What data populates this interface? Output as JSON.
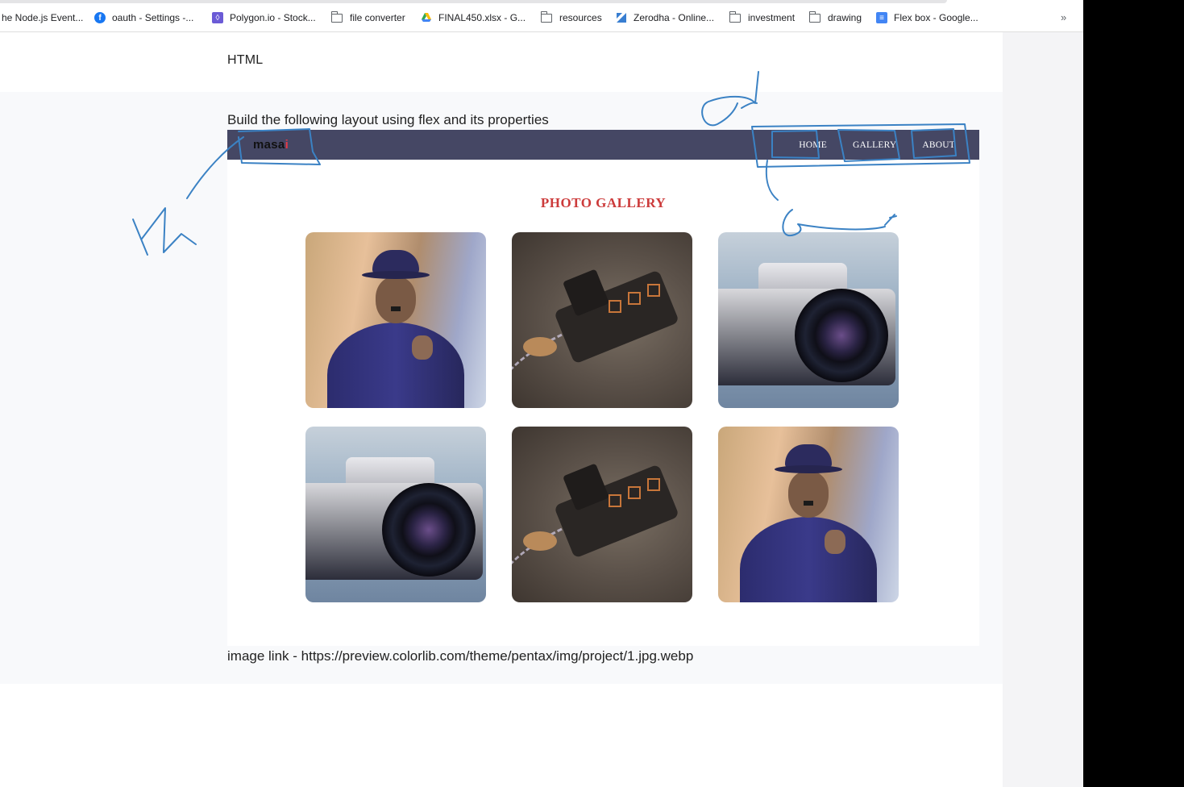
{
  "bookmarks": [
    {
      "label": "he Node.js Event...",
      "icon": "none"
    },
    {
      "label": "oauth - Settings -...",
      "icon": "facebook-icon"
    },
    {
      "label": "Polygon.io - Stock...",
      "icon": "polygon-icon"
    },
    {
      "label": "file converter",
      "icon": "folder-icon"
    },
    {
      "label": "FINAL450.xlsx - G...",
      "icon": "drive-icon"
    },
    {
      "label": "resources",
      "icon": "folder-icon"
    },
    {
      "label": "Zerodha - Online...",
      "icon": "zerodha-icon"
    },
    {
      "label": "investment",
      "icon": "folder-icon"
    },
    {
      "label": "drawing",
      "icon": "folder-icon"
    },
    {
      "label": "Flex box - Google...",
      "icon": "docs-icon"
    }
  ],
  "bookmarks_overflow": "»",
  "doc": {
    "heading": "HTML",
    "task": "Build the following layout using flex and its properties",
    "image_link": "image link - https://preview.colorlib.com/theme/pentax/img/project/1.jpg.webp"
  },
  "example": {
    "logo_text": "masa",
    "logo_dot": "i",
    "nav": [
      "HOME",
      "GALLERY",
      "ABOUT"
    ],
    "gallery_title": "PHOTO GALLERY",
    "photos": [
      "figurine",
      "train",
      "camera",
      "camera",
      "train",
      "figurine"
    ]
  },
  "colors": {
    "nav_bg": "#454764",
    "gallery_title": "#cc3b3b",
    "annotation_ink": "#3b82c4"
  }
}
